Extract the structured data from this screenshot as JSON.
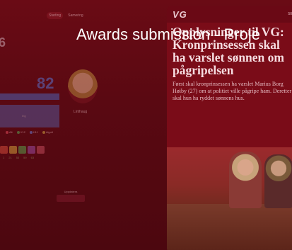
{
  "overlay": {
    "title": "Awards submission - Proje"
  },
  "dashboard": {
    "tabs": [
      "Starting",
      "Samering"
    ],
    "big_number": "6",
    "score": "82",
    "bar_label": "Ing",
    "avatar_name": "Linthaug",
    "legend": [
      "Alt",
      "V12",
      "H11",
      "Algo6"
    ],
    "tile_labels": [
      "1",
      "21",
      "53",
      "59",
      "63"
    ],
    "widget_label": "Uppdatera"
  },
  "article": {
    "brand": "VG",
    "status": "50",
    "headline_line1": "Opplysninger til VG:",
    "headline_rest": "Kronprinsessen skal ha varslet sønnen om pågripelsen",
    "body": "Først skal kronprinsessen ha varslet Marius Borg Høiby (27) om at politiet ville pågripe ham. Deretter skal hun ha ryddet sønnens hus."
  },
  "colors": {
    "tint": "#6a0b15",
    "accent": "#5466b5"
  }
}
